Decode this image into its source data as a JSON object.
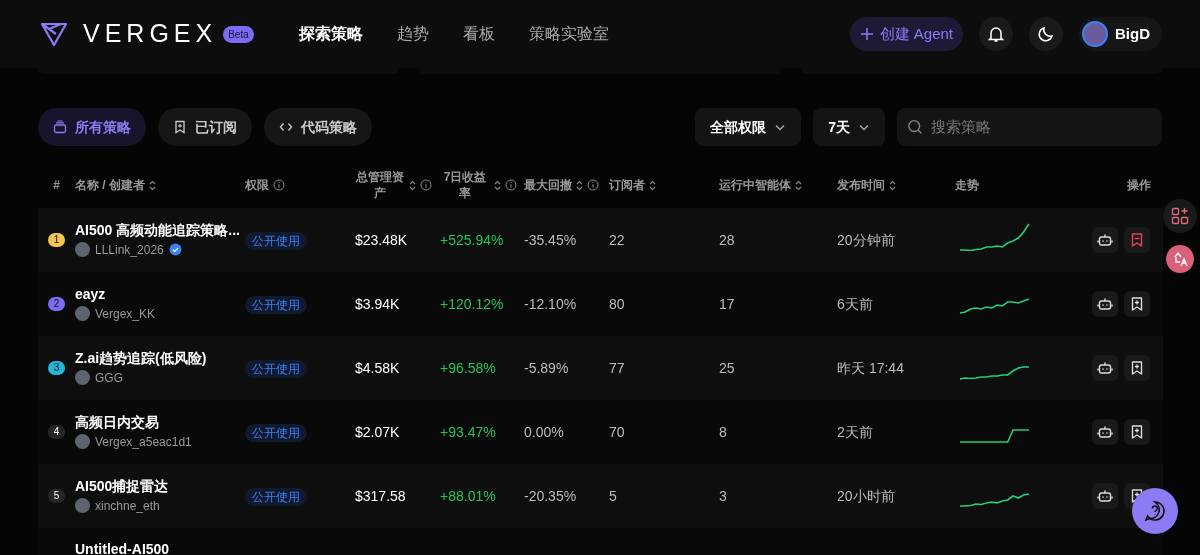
{
  "header": {
    "logo_text": "VERGEX",
    "badge": "Beta",
    "nav": [
      {
        "label": "探索策略",
        "selected": true
      },
      {
        "label": "趋势",
        "selected": false
      },
      {
        "label": "看板",
        "selected": false
      },
      {
        "label": "策略实验室",
        "selected": false
      }
    ],
    "create_button": "创建 Agent",
    "user": "BigD"
  },
  "filters": {
    "tabs": [
      {
        "label": "所有策略",
        "selected": true,
        "kind": "all"
      },
      {
        "label": "已订阅",
        "selected": false,
        "kind": "subscribed"
      },
      {
        "label": "代码策略",
        "selected": false,
        "kind": "code"
      }
    ],
    "permission_dropdown": "全部权限",
    "period_dropdown": "7天",
    "search": {
      "placeholder": "搜索策略"
    }
  },
  "table": {
    "columns": [
      {
        "label": "#",
        "sortable": false,
        "info": false
      },
      {
        "label": "名称 / 创建者",
        "sortable": true,
        "info": false
      },
      {
        "label": "权限",
        "sortable": false,
        "info": true
      },
      {
        "label": "总管理资产",
        "sortable": true,
        "info": true
      },
      {
        "label": "7日收益率",
        "sortable": true,
        "info": true
      },
      {
        "label": "最大回撤",
        "sortable": true,
        "info": true
      },
      {
        "label": "订阅者",
        "sortable": true,
        "info": false
      },
      {
        "label": "运行中智能体",
        "sortable": true,
        "info": false
      },
      {
        "label": "发布时间",
        "sortable": true,
        "info": false
      },
      {
        "label": "走势",
        "sortable": false,
        "info": false
      },
      {
        "label": "操作",
        "sortable": false,
        "info": false
      }
    ],
    "rows": [
      {
        "rank": "1",
        "color": "#f5c451",
        "name": "AI500 高频动能追踪策略...",
        "creator": "LLLink_2026",
        "verified": true,
        "permission": "公开使用",
        "aum": "$23.48K",
        "return": "+525.94%",
        "drawdown": "-35.45%",
        "subscribers": "22",
        "agents": "28",
        "published": "20分钟前",
        "subscribed": true
      },
      {
        "rank": "2",
        "color": "#7c6cf2",
        "name": "eayz",
        "creator": "Vergex_KK",
        "verified": false,
        "permission": "公开使用",
        "aum": "$3.94K",
        "return": "+120.12%",
        "drawdown": "-12.10%",
        "subscribers": "80",
        "agents": "17",
        "published": "6天前",
        "subscribed": false
      },
      {
        "rank": "3",
        "color": "#22b8d6",
        "name": "Z.ai趋势追踪(低风险)",
        "creator": "GGG",
        "verified": false,
        "permission": "公开使用",
        "aum": "$4.58K",
        "return": "+96.58%",
        "drawdown": "-5.89%",
        "subscribers": "77",
        "agents": "25",
        "published": "昨天 17:44",
        "subscribed": false
      },
      {
        "rank": "4",
        "color": "#262626",
        "name": "高频日内交易",
        "creator": "Vergex_a5eac1d1",
        "verified": false,
        "permission": "公开使用",
        "aum": "$2.07K",
        "return": "+93.47%",
        "drawdown": "0.00%",
        "subscribers": "70",
        "agents": "8",
        "published": "2天前",
        "subscribed": false
      },
      {
        "rank": "5",
        "color": "#262626",
        "name": "AI500捕捉雷达",
        "creator": "xinchne_eth",
        "verified": false,
        "permission": "公开使用",
        "aum": "$317.58",
        "return": "+88.01%",
        "drawdown": "-20.35%",
        "subscribers": "5",
        "agents": "3",
        "published": "20小时前",
        "subscribed": false
      },
      {
        "name": "Untitled-AI500"
      }
    ]
  }
}
